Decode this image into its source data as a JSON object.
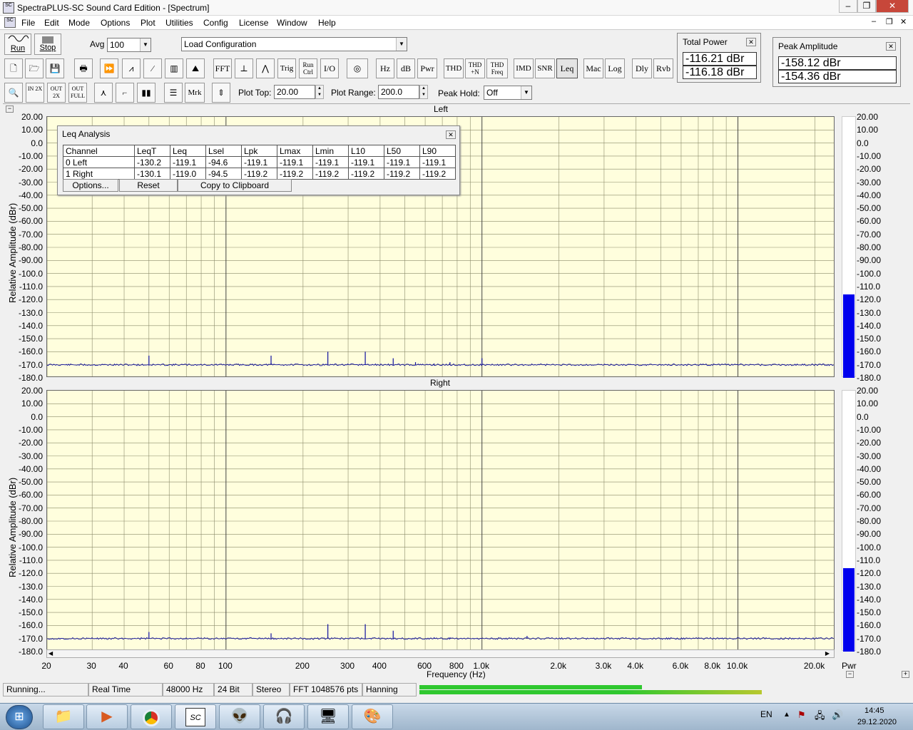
{
  "window": {
    "title": "SpectraPLUS-SC Sound Card Edition - [Spectrum]",
    "app_icon_text": "SC",
    "minimize": "‒",
    "restore": "❐",
    "close": "✕",
    "mdi_min": "‒",
    "mdi_restore": "❐",
    "mdi_close": "✕"
  },
  "menu": [
    "File",
    "Edit",
    "Mode",
    "Options",
    "Plot",
    "Utilities",
    "Config",
    "License",
    "Window",
    "Help"
  ],
  "toolbar1": {
    "run": "Run",
    "stop": "Stop",
    "avg_label": "Avg",
    "avg_value": "100",
    "config": "Load Configuration"
  },
  "toolbar2": [
    "FFT",
    "Trig",
    "Run Ctrl",
    "I/O",
    "Hz",
    "dB",
    "Pwr",
    "THD",
    "THD +N",
    "THD Freq",
    "IMD",
    "SNR",
    "Leq",
    "Mac",
    "Log",
    "Dly",
    "Rvb"
  ],
  "toolbar3": {
    "mrk": "Mrk",
    "plot_top_label": "Plot Top:",
    "plot_top": "20.00",
    "plot_range_label": "Plot Range:",
    "plot_range": "200.0",
    "peak_hold_label": "Peak Hold:",
    "peak_hold": "Off",
    "zoom_in": "IN 2X",
    "zoom_out": "OUT 2X",
    "zoom_full": "OUT FULL"
  },
  "total_power": {
    "title": "Total Power",
    "values": [
      "-116.21 dBr",
      "-116.18 dBr"
    ]
  },
  "peak_amplitude": {
    "title": "Peak Amplitude",
    "values": [
      "-158.12 dBr",
      "-154.36 dBr"
    ]
  },
  "plots": [
    {
      "title": "Left",
      "ylabel": "Relative Amplitude (dBr)",
      "meter_level": -116.21
    },
    {
      "title": "Right",
      "ylabel": "Relative Amplitude (dBr)",
      "meter_level": -116.18
    }
  ],
  "y_ticks": [
    "20.00",
    "10.00",
    "0.0",
    "-10.00",
    "-20.00",
    "-30.00",
    "-40.00",
    "-50.00",
    "-60.00",
    "-70.00",
    "-80.00",
    "-90.00",
    "-100.0",
    "-110.0",
    "-120.0",
    "-130.0",
    "-140.0",
    "-150.0",
    "-160.0",
    "-170.0",
    "-180.0"
  ],
  "x_ticks": [
    {
      "f": 20,
      "label": "20"
    },
    {
      "f": 30,
      "label": "30"
    },
    {
      "f": 40,
      "label": "40"
    },
    {
      "f": 60,
      "label": "60"
    },
    {
      "f": 80,
      "label": "80"
    },
    {
      "f": 100,
      "label": "100"
    },
    {
      "f": 200,
      "label": "200"
    },
    {
      "f": 300,
      "label": "300"
    },
    {
      "f": 400,
      "label": "400"
    },
    {
      "f": 600,
      "label": "600"
    },
    {
      "f": 800,
      "label": "800"
    },
    {
      "f": 1000,
      "label": "1.0k"
    },
    {
      "f": 2000,
      "label": "2.0k"
    },
    {
      "f": 3000,
      "label": "3.0k"
    },
    {
      "f": 4000,
      "label": "4.0k"
    },
    {
      "f": 6000,
      "label": "6.0k"
    },
    {
      "f": 8000,
      "label": "8.0k"
    },
    {
      "f": 10000,
      "label": "10.0k"
    },
    {
      "f": 20000,
      "label": "20.0k"
    }
  ],
  "xlabel": "Frequency (Hz)",
  "pwr_label": "Pwr",
  "spectrum": {
    "left_peaks": [
      [
        50,
        -163
      ],
      [
        150,
        -163
      ],
      [
        250,
        -160
      ],
      [
        350,
        -160
      ],
      [
        450,
        -165
      ],
      [
        550,
        -168
      ],
      [
        650,
        -169
      ],
      [
        750,
        -168
      ],
      [
        1000,
        -165
      ]
    ],
    "right_peaks": [
      [
        50,
        -165
      ],
      [
        150,
        -166
      ],
      [
        250,
        -159
      ],
      [
        350,
        -159
      ],
      [
        450,
        -164
      ],
      [
        650,
        -169
      ],
      [
        750,
        -169
      ],
      [
        1500,
        -168
      ]
    ]
  },
  "leq": {
    "title": "Leq Analysis",
    "headers": [
      "Channel",
      "LeqT",
      "Leq",
      "Lsel",
      "Lpk",
      "Lmax",
      "Lmin",
      "L10",
      "L50",
      "L90"
    ],
    "rows": [
      [
        "0 Left",
        "-130.2",
        "-119.1",
        "-94.6",
        "-119.1",
        "-119.1",
        "-119.1",
        "-119.1",
        "-119.1",
        "-119.1"
      ],
      [
        "1 Right",
        "-130.1",
        "-119.0",
        "-94.5",
        "-119.2",
        "-119.2",
        "-119.2",
        "-119.2",
        "-119.2",
        "-119.2"
      ]
    ],
    "options": "Options...",
    "reset": "Reset",
    "copy": "Copy to Clipboard"
  },
  "status": [
    "Running...",
    "Real Time",
    "48000 Hz",
    "24 Bit",
    "Stereo",
    "FFT 1048576 pts",
    "Hanning"
  ],
  "progress": [
    0.52,
    0.8
  ],
  "taskbar": {
    "lang": "EN",
    "time": "14:45",
    "date": "29.12.2020"
  }
}
